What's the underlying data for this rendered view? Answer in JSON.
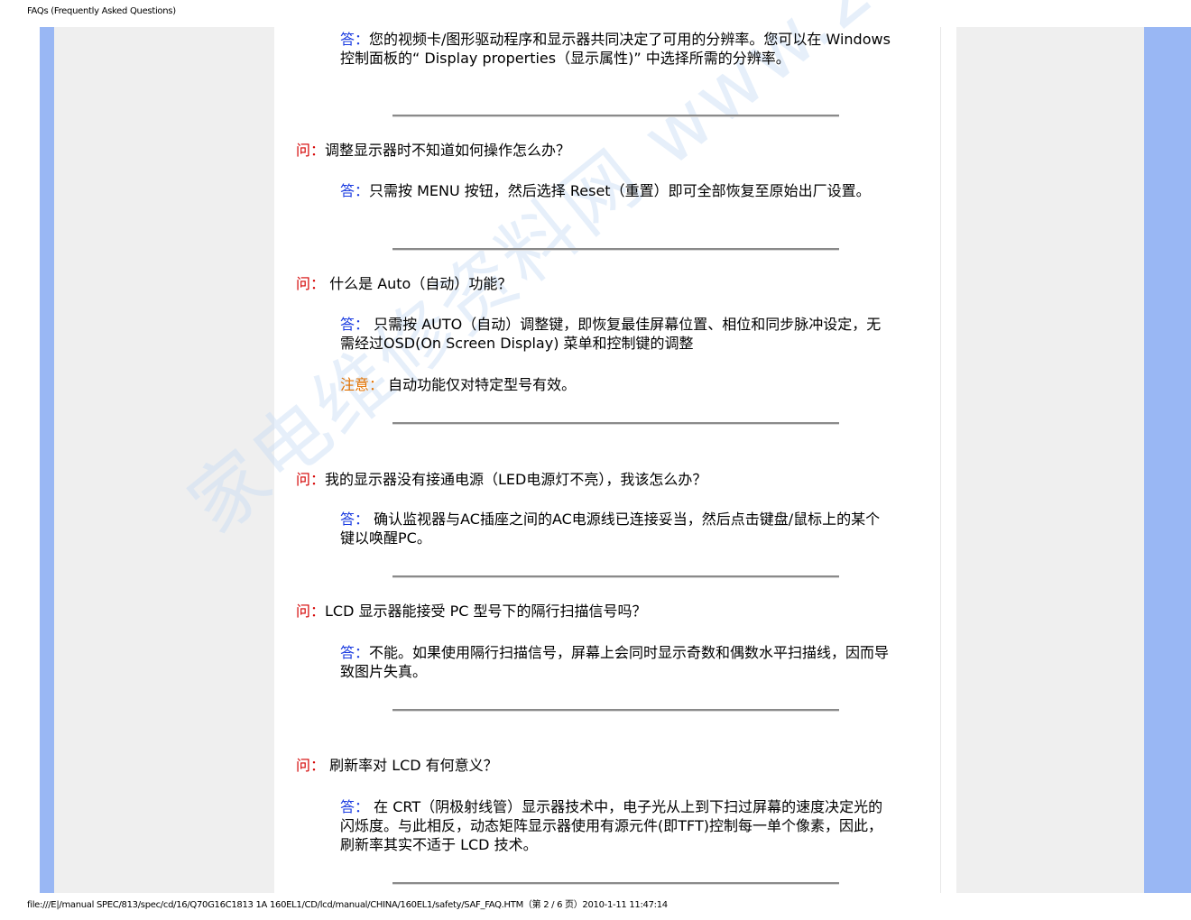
{
  "header": {
    "title": "FAQs (Frequently Asked Questions)"
  },
  "footer": {
    "text": "file:///E|/manual SPEC/813/spec/cd/16/Q70G16C1813 1A 160EL1/CD/lcd/manual/CHINA/160EL1/safety/SAF_FAQ.HTM（第 2 / 6 页）2010-1-11 11:47:14"
  },
  "watermark": "家电维修资料网 www.20101.com",
  "colors": {
    "side_blue": "#99b7f4",
    "side_gray": "#efefef",
    "question_label": "#d40000",
    "answer_label": "#1a3be0",
    "note_label": "#e07000"
  },
  "faq": {
    "a0": {
      "label": "答：",
      "text": "您的视频卡/图形驱动程序和显示器共同决定了可用的分辨率。您可以在 Windows 控制面板的“ Display properties（显示属性)” 中选择所需的分辨率。"
    },
    "q1": {
      "label": "问：",
      "text": "调整显示器时不知道如何操作怎么办？"
    },
    "a1": {
      "label": "答：",
      "text": "只需按 MENU 按钮，然后选择 Reset（重置）即可全部恢复至原始出厂设置。"
    },
    "q2": {
      "label": "问：",
      "text": " 什么是 Auto（自动）功能？"
    },
    "a2": {
      "label": "答：",
      "text": " 只需按 AUTO（自动）调整键，即恢复最佳屏幕位置、相位和同步脉冲设定，无需经过OSD(On Screen Display) 菜单和控制键的调整"
    },
    "n2": {
      "label": "注意：",
      "text": " 自动功能仅对特定型号有效。"
    },
    "q3": {
      "label": "问：",
      "text": "我的显示器没有接通电源（LED电源灯不亮），我该怎么办？"
    },
    "a3": {
      "label": "答：",
      "text": " 确认监视器与AC插座之间的AC电源线已连接妥当，然后点击键盘/鼠标上的某个键以唤醒PC。"
    },
    "q4": {
      "label": "问：",
      "text": "LCD 显示器能接受 PC 型号下的隔行扫描信号吗？"
    },
    "a4": {
      "label": "答：",
      "text": "不能。如果使用隔行扫描信号，屏幕上会同时显示奇数和偶数水平扫描线，因而导致图片失真。"
    },
    "q5": {
      "label": "问：",
      "text": " 刷新率对 LCD 有何意义？"
    },
    "a5": {
      "label": "答：",
      "text": " 在 CRT（阴极射线管）显示器技术中，电子光从上到下扫过屏幕的速度决定光的闪烁度。与此相反，动态矩阵显示器使用有源元件(即TFT)控制每一单个像素，因此，刷新率其实不适于 LCD 技术。"
    }
  }
}
